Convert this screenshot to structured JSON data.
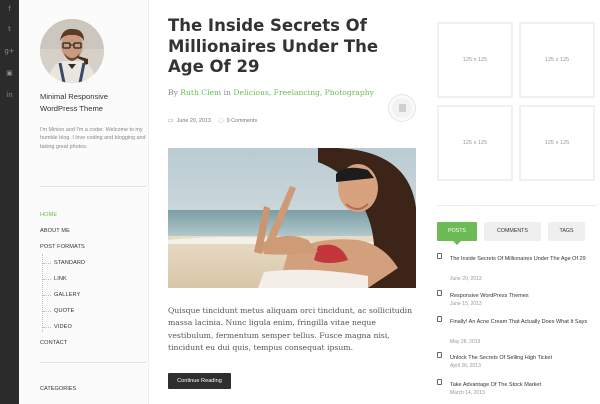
{
  "social": {
    "icons": [
      {
        "name": "facebook-icon",
        "glyph": "f"
      },
      {
        "name": "twitter-icon",
        "glyph": "t"
      },
      {
        "name": "google-plus-icon",
        "glyph": "g+"
      },
      {
        "name": "youtube-icon",
        "glyph": "▣"
      },
      {
        "name": "linkedin-icon",
        "glyph": "in"
      }
    ]
  },
  "profile": {
    "site_title": "Minimal Responsive WordPress Theme",
    "bio": "I'm Minion and I'm a coder. Welcome to my humble blog. I love coding and blogging and taking great photos."
  },
  "nav": {
    "items": [
      {
        "label": "HOME",
        "active": true
      },
      {
        "label": "ABOUT ME"
      },
      {
        "label": "POST FORMATS"
      },
      {
        "label": "STANDARD",
        "sub": true
      },
      {
        "label": "LINK",
        "sub": true
      },
      {
        "label": "GALLERY",
        "sub": true
      },
      {
        "label": "QUOTE",
        "sub": true
      },
      {
        "label": "VIDEO",
        "sub": true
      },
      {
        "label": "CONTACT"
      }
    ],
    "categories_heading": "CATEGORIES"
  },
  "post": {
    "title": "The Inside Secrets Of Millionaires Under The Age Of 29",
    "byline_prefix": "By",
    "author": "Ruth Clem",
    "byline_in": "in",
    "categories": "Delicious, Freelancing, Photography",
    "date": "June 20, 2013",
    "comments": "9 Comments",
    "excerpt": "Quisque tincidunt metus aliquam orci tincidunt, ac sollicitudin massa lacinia. Nunc ligula enim, fringilla vitae neque vestibulum, fermentum semper tellus. Fusce magna nisi, tincidunt eu dui quis, tempus consequat ipsum.",
    "continue_label": "Continue Reading"
  },
  "ads": {
    "label": "125 x 125"
  },
  "tabs": [
    "POSTS",
    "COMMENTS",
    "TAGS"
  ],
  "posts_list": [
    {
      "title": "The Inside Secrets Of Millionaires Under The Age Of 29",
      "date": "June 20, 2013"
    },
    {
      "title": "Responsive WordPress Themes",
      "date": "June 15, 2013"
    },
    {
      "title": "Finally! An Acne Cream That Actually Does What It Says",
      "date": "May 28, 2013"
    },
    {
      "title": "Unlock The Secrets Of Selling High Ticket",
      "date": "April 26, 2013"
    },
    {
      "title": "Take Advantage Of The Stock Market",
      "date": "March 14, 2013"
    }
  ],
  "colors": {
    "accent": "#6cbb55",
    "dark": "#2b2b2b",
    "button": "#2f2f2f"
  }
}
